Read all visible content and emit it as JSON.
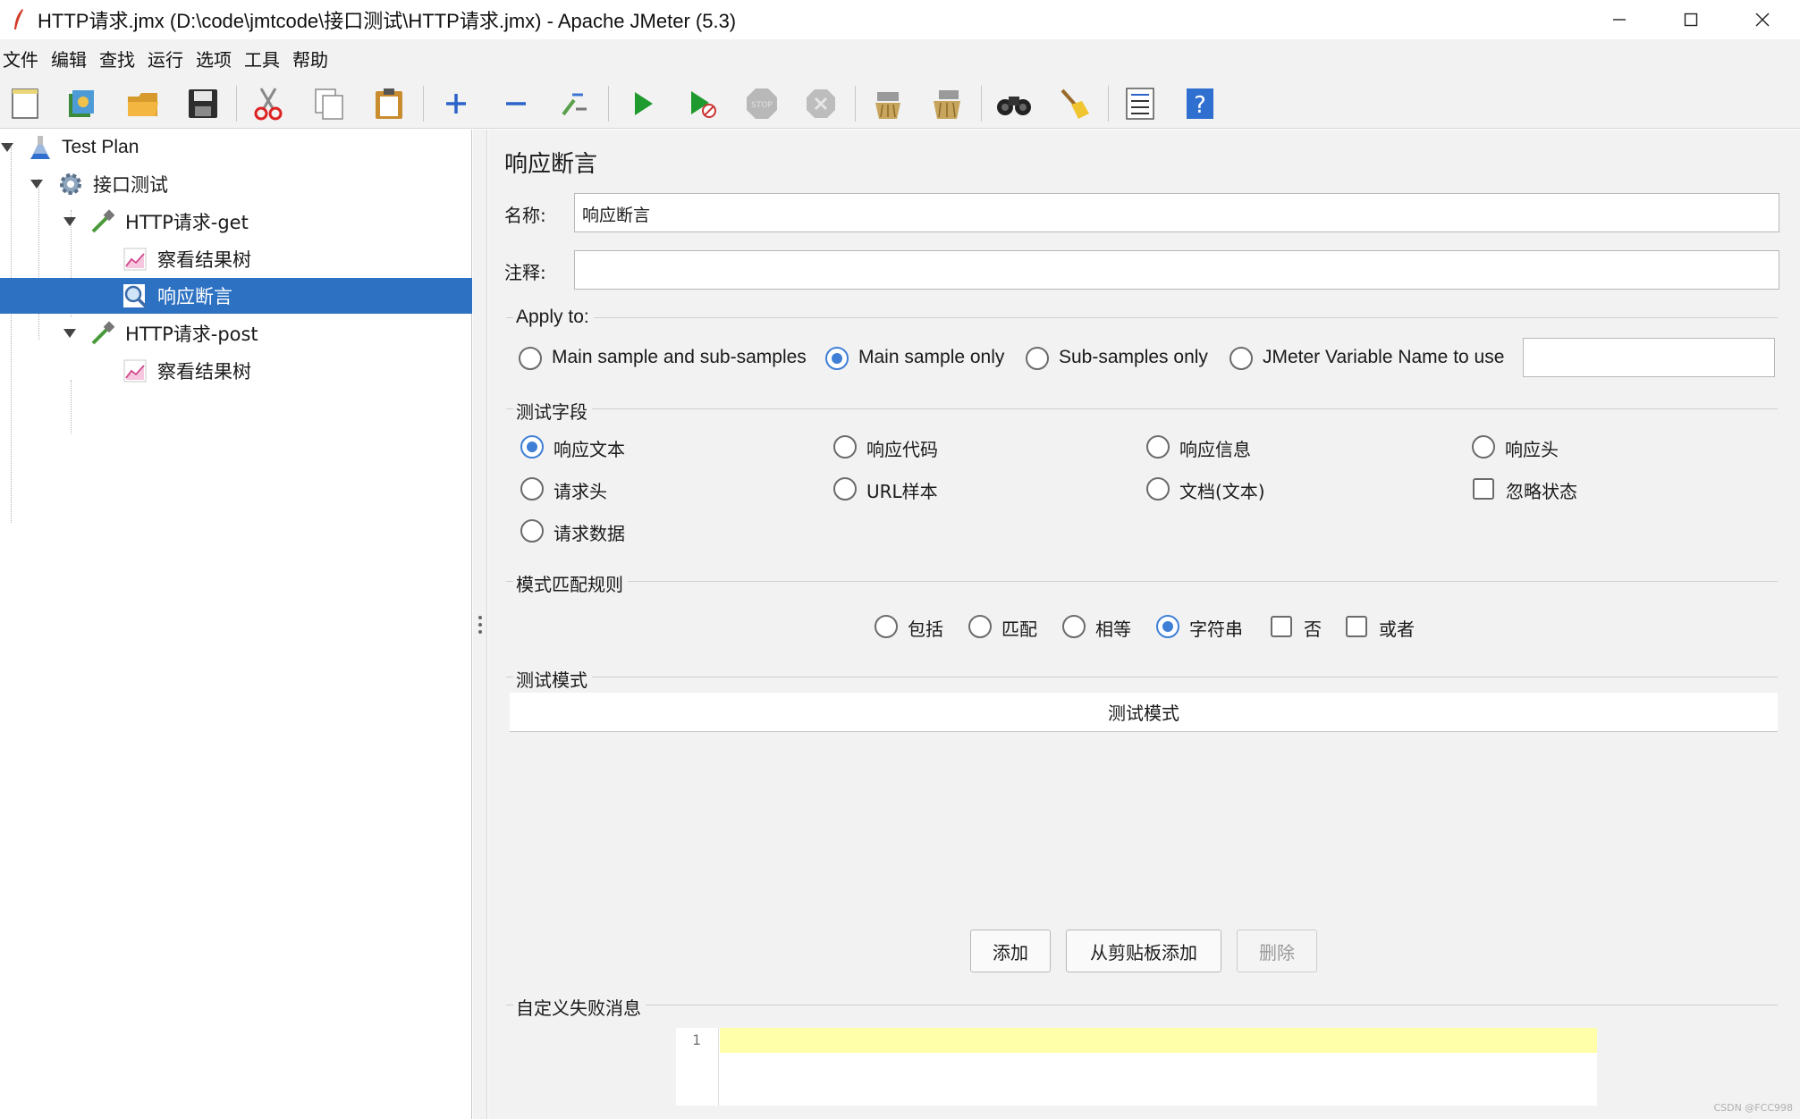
{
  "window": {
    "title": "HTTP请求.jmx (D:\\code\\jmtcode\\接口测试\\HTTP请求.jmx) - Apache JMeter (5.3)"
  },
  "menu": [
    "文件",
    "编辑",
    "查找",
    "运行",
    "选项",
    "工具",
    "帮助"
  ],
  "toolbar": [
    {
      "icon": "new-icon"
    },
    {
      "icon": "templates-icon"
    },
    {
      "icon": "open-icon"
    },
    {
      "icon": "save-icon"
    },
    {
      "icon": "cut-icon"
    },
    {
      "icon": "copy-icon"
    },
    {
      "icon": "paste-icon"
    },
    {
      "icon": "expand-icon"
    },
    {
      "icon": "collapse-icon"
    },
    {
      "icon": "toggle-icon"
    },
    {
      "icon": "start-icon"
    },
    {
      "icon": "start-no-pauses-icon"
    },
    {
      "icon": "stop-icon"
    },
    {
      "icon": "shutdown-icon"
    },
    {
      "icon": "clear-icon"
    },
    {
      "icon": "clear-all-icon"
    },
    {
      "icon": "search-icon"
    },
    {
      "icon": "reset-search-icon"
    },
    {
      "icon": "function-helper-icon"
    },
    {
      "icon": "help-icon"
    }
  ],
  "tree": [
    {
      "label": "Test Plan",
      "icon": "test-plan-icon"
    },
    {
      "label": "接口测试",
      "icon": "thread-group-icon"
    },
    {
      "label": "HTTP请求-get",
      "icon": "sampler-icon"
    },
    {
      "label": "察看结果树",
      "icon": "listener-icon"
    },
    {
      "label": "响应断言",
      "icon": "assertion-icon",
      "selected": true
    },
    {
      "label": "HTTP请求-post",
      "icon": "sampler-icon"
    },
    {
      "label": "察看结果树",
      "icon": "listener-icon"
    }
  ],
  "panel": {
    "title": "响应断言",
    "name_label": "名称:",
    "name_value": "响应断言",
    "comment_label": "注释:",
    "comment_value": "",
    "apply_to": {
      "title": "Apply to:",
      "options": [
        "Main sample and sub-samples",
        "Main sample only",
        "Sub-samples only",
        "JMeter Variable Name to use"
      ],
      "selected": "Main sample only",
      "variable_value": ""
    },
    "test_field": {
      "title": "测试字段",
      "options": [
        "响应文本",
        "响应代码",
        "响应信息",
        "响应头",
        "请求头",
        "URL样本",
        "文档(文本)",
        "请求数据"
      ],
      "selected": "响应文本",
      "ignore_status_label": "忽略状态",
      "ignore_status_checked": false
    },
    "pattern_rules": {
      "title": "模式匹配规则",
      "options": [
        "包括",
        "匹配",
        "相等",
        "字符串"
      ],
      "selected": "字符串",
      "not_label": "否",
      "not_checked": false,
      "or_label": "或者",
      "or_checked": false
    },
    "patterns": {
      "title": "测试模式",
      "column_header": "测试模式",
      "rows": []
    },
    "buttons": {
      "add": "添加",
      "add_clipboard": "从剪贴板添加",
      "delete": "删除"
    },
    "failure_message": {
      "title": "自定义失败消息",
      "line_number": "1",
      "text": ""
    }
  },
  "watermark": "CSDN @FCC998"
}
